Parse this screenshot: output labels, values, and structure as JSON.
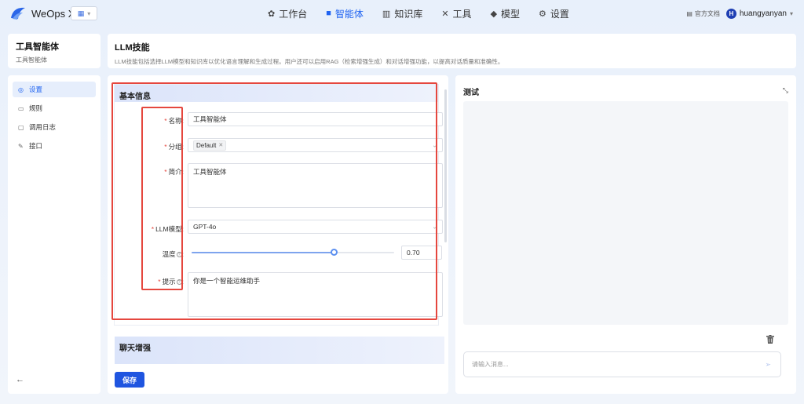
{
  "app": {
    "name": "WeOps X"
  },
  "nav": {
    "items": [
      {
        "label": "工作台",
        "icon": "robot-icon"
      },
      {
        "label": "智能体",
        "icon": "agent-icon",
        "active": true
      },
      {
        "label": "知识库",
        "icon": "books-icon"
      },
      {
        "label": "工具",
        "icon": "tools-icon"
      },
      {
        "label": "模型",
        "icon": "cube-icon"
      },
      {
        "label": "设置",
        "icon": "gear-icon"
      }
    ],
    "accent": "#1f63f1"
  },
  "header_right": {
    "docs": "官方文档",
    "avatar_letter": "H",
    "username": "huangyanyan"
  },
  "agent": {
    "name": "工具智能体",
    "subtitle": "工具智能体"
  },
  "page": {
    "title": "LLM技能",
    "description": "LLM技能包括选择LLM模型和知识库以优化语言理解和生成过程。用户还可以启用RAG（检索增强生成）和对话增强功能，以提高对话质量和准确性。"
  },
  "sidebar": {
    "items": [
      {
        "label": "设置",
        "icon": "settings-icon",
        "active": true
      },
      {
        "label": "规则",
        "icon": "rules-icon"
      },
      {
        "label": "调用日志",
        "icon": "log-icon"
      },
      {
        "label": "接口",
        "icon": "link-icon"
      }
    ]
  },
  "basic_info": {
    "title": "基本信息",
    "fields": {
      "name": {
        "label": "名称",
        "value": "工具智能体"
      },
      "group": {
        "label": "分组",
        "tag": "Default"
      },
      "intro": {
        "label": "简介",
        "value": "工具智能体"
      },
      "llm_model": {
        "label": "LLM模型",
        "value": "GPT-4o"
      },
      "temperature": {
        "label": "温度",
        "value": "0.70",
        "fraction": 0.7
      },
      "prompt": {
        "label": "提示",
        "value": "你是一个智能运维助手"
      }
    }
  },
  "chat_enhance": {
    "title": "聊天增强"
  },
  "save_label": "保存",
  "test": {
    "title": "测试",
    "placeholder": "请输入消息..."
  },
  "colors": {
    "highlight": "#e5473e",
    "primary_button": "#1f55e0"
  }
}
